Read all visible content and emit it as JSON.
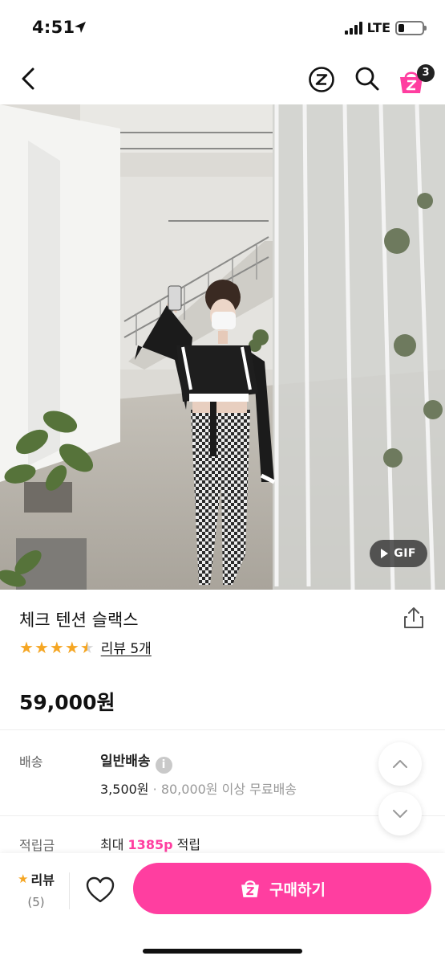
{
  "status": {
    "time": "4:51",
    "network": "LTE",
    "battery_level": 0.25
  },
  "nav": {
    "icons": [
      "back-icon",
      "zigzag-logo-icon",
      "search-icon",
      "cart-icon"
    ],
    "cart_count": "3"
  },
  "hero": {
    "gif_label": "GIF"
  },
  "product": {
    "title": "체크 텐션 슬랙스",
    "rating": 4.5,
    "review_link": "리뷰 5개",
    "price": "59,000원"
  },
  "shipping": {
    "label": "배송",
    "type": "일반배송",
    "info_glyph": "i",
    "fee": "3,500원",
    "separator": "·",
    "free_condition": "80,000원 이상 무료배송"
  },
  "points": {
    "label": "적립금",
    "prefix": "최대",
    "amount": "1385p",
    "suffix": "적립"
  },
  "bottom_bar": {
    "review_label": "리뷰",
    "review_count": "(5)",
    "buy_label": "구매하기"
  },
  "colors": {
    "accent": "#ff3ea0",
    "star": "#f5a623"
  }
}
